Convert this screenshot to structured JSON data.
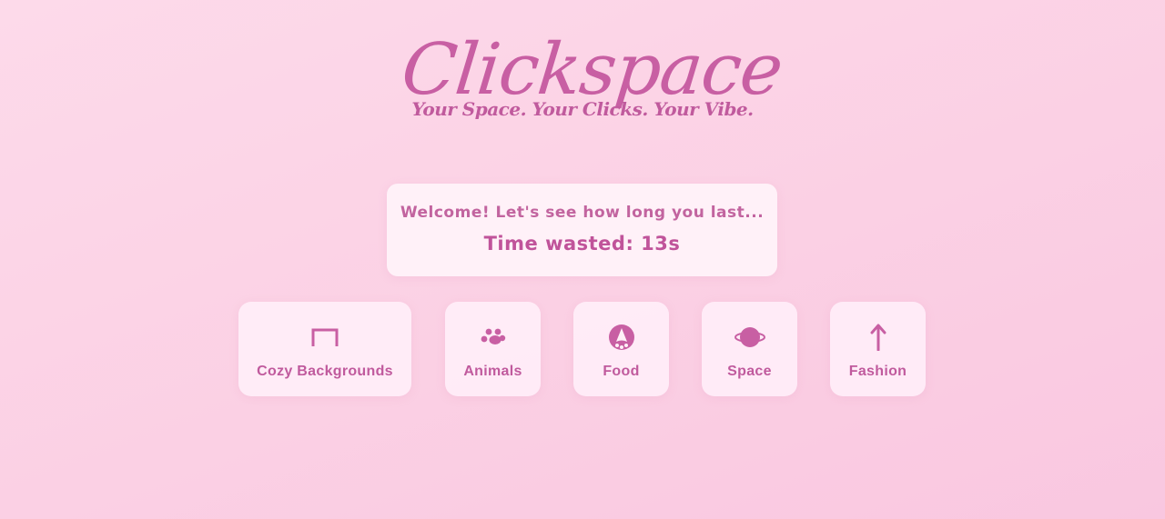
{
  "app": {
    "title": "Clickspace",
    "tagline": "Your Space. Your Clicks. Your Vibe."
  },
  "welcome": {
    "message": "Welcome! Let's see how long you last...",
    "timer_label": "Time wasted: 13s"
  },
  "categories": [
    {
      "label": "Cozy Backgrounds",
      "icon": "frame-icon"
    },
    {
      "label": "Animals",
      "icon": "paw-icon"
    },
    {
      "label": "Food",
      "icon": "cookie-icon"
    },
    {
      "label": "Space",
      "icon": "planet-icon"
    },
    {
      "label": "Fashion",
      "icon": "arrow-up-icon"
    }
  ],
  "colors": {
    "accent": "#c85fa3",
    "background": "#fbd0e4",
    "card": "#fff4fa"
  }
}
